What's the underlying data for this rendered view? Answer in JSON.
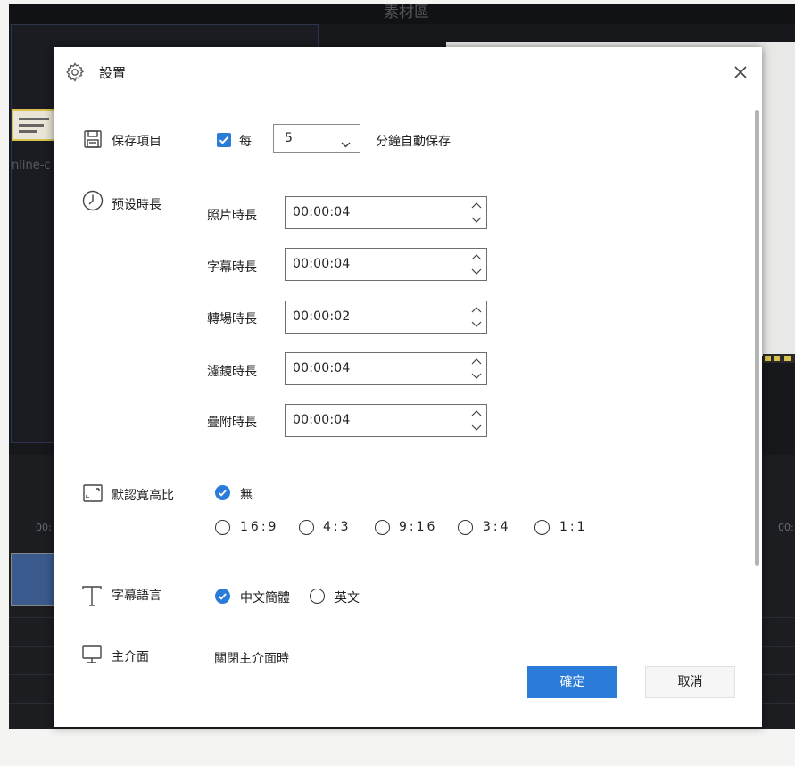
{
  "background": {
    "title": "素材區",
    "file_label": "nline-c",
    "timeline_ticks": [
      "00:",
      "00:"
    ]
  },
  "dialog": {
    "title": "設置",
    "title_icon": "gear-icon",
    "close_icon": "close-icon",
    "autosave": {
      "label": "保存項目",
      "icon": "save-icon",
      "checkbox_checked": true,
      "checkbox_label": "每",
      "interval_value": "5",
      "suffix": "分鐘自動保存"
    },
    "default_duration": {
      "label": "预设時長",
      "icon": "clock-icon",
      "fields": [
        {
          "label": "照片時長",
          "value": "00:00:04"
        },
        {
          "label": "字幕時長",
          "value": "00:00:04"
        },
        {
          "label": "轉場時長",
          "value": "00:00:02"
        },
        {
          "label": "濾鏡時長",
          "value": "00:00:04"
        },
        {
          "label": "疊附時長",
          "value": "00:00:04"
        }
      ]
    },
    "aspect_ratio": {
      "label": "默認寬高比",
      "icon": "aspect-ratio-icon",
      "selected": "無",
      "options": [
        "無",
        "16:9",
        "4:3",
        "9:16",
        "3:4",
        "1:1"
      ]
    },
    "subtitle_language": {
      "label": "字幕語言",
      "icon": "text-icon",
      "selected": "中文簡體",
      "options": [
        "中文簡體",
        "英文"
      ]
    },
    "main_interface": {
      "label": "主介面",
      "icon": "monitor-icon",
      "text": "關閉主介面時"
    },
    "buttons": {
      "ok": "確定",
      "cancel": "取消"
    },
    "colors": {
      "accent": "#2b7cd9",
      "dialog_bg": "#ffffff",
      "app_bg": "#17181c"
    }
  }
}
